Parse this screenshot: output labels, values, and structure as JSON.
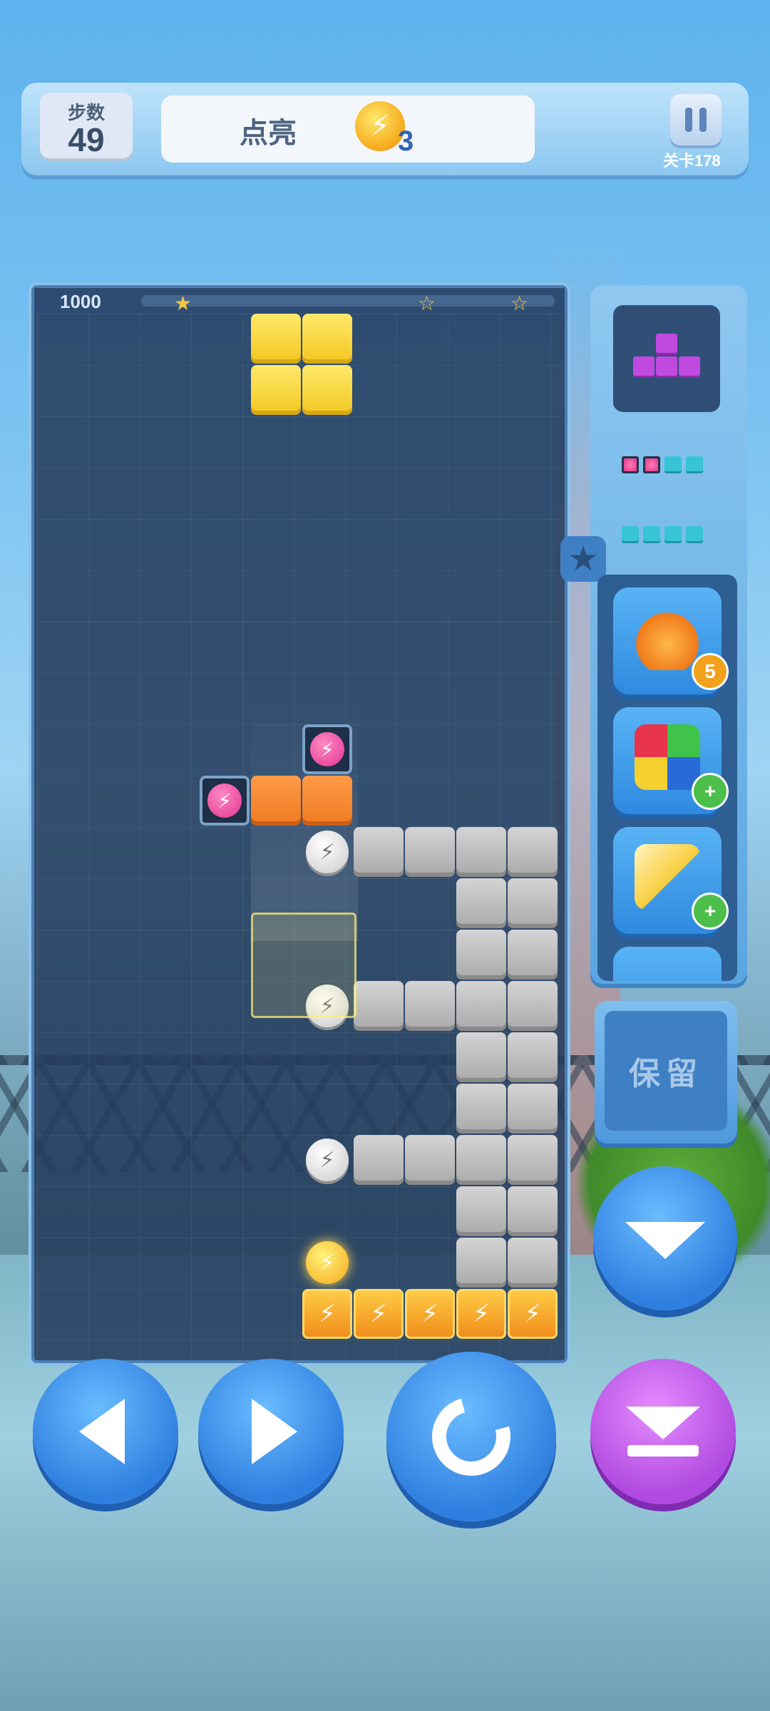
{
  "header": {
    "moves_label": "步数",
    "moves_value": "49",
    "goal_label": "点亮",
    "goal_icon": "lightbulb-icon",
    "goal_count": "3",
    "level_label": "关卡178"
  },
  "board": {
    "score": "1000",
    "score_progress": 0.02,
    "star_thresholds": 3
  },
  "side": {
    "hold_label": "保留",
    "tools": [
      {
        "name": "undo-potion",
        "icon": "potion-icon",
        "badge": "5"
      },
      {
        "name": "color-blocks",
        "icon": "blocks-icon",
        "badge": "+"
      },
      {
        "name": "paper-plane",
        "icon": "paper-plane-icon",
        "badge": "+"
      }
    ]
  },
  "controls": [
    "move-left",
    "move-right",
    "rotate",
    "soft-drop",
    "hard-drop"
  ],
  "colors": {
    "board_bg": "#243c5c",
    "yellow": "#f2c71f",
    "orange": "#f07920",
    "button_blue": "#2f7fe0",
    "button_purple": "#b04ae0"
  }
}
